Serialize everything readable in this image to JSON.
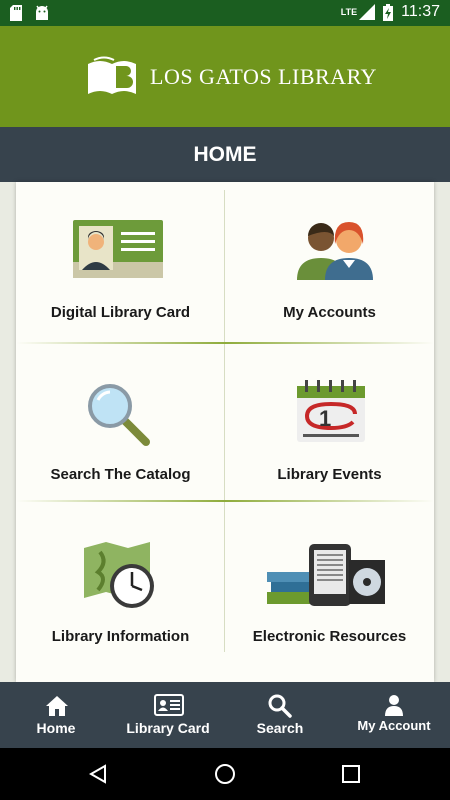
{
  "status_bar": {
    "time": "11:37",
    "network": "LTE",
    "icons": [
      "sd-card-icon",
      "android-icon",
      "signal-icon",
      "battery-charging-icon"
    ]
  },
  "brand": {
    "name": "LOS GATOS LIBRARY",
    "color": "#70951c"
  },
  "header": {
    "title": "HOME",
    "color": "#37434d"
  },
  "tiles": [
    {
      "label": "Digital Library Card",
      "icon": "library-card-icon"
    },
    {
      "label": "My Accounts",
      "icon": "accounts-people-icon"
    },
    {
      "label": "Search The Catalog",
      "icon": "magnifier-icon"
    },
    {
      "label": "Library Events",
      "icon": "calendar-icon"
    },
    {
      "label": "Library Information",
      "icon": "map-clock-icon"
    },
    {
      "label": "Electronic Resources",
      "icon": "books-ereader-disc-icon"
    }
  ],
  "bottom_nav": [
    {
      "label": "Home",
      "icon": "home-icon"
    },
    {
      "label": "Library Card",
      "icon": "id-card-icon"
    },
    {
      "label": "Search",
      "icon": "search-icon"
    },
    {
      "label": "My Account",
      "icon": "person-icon"
    }
  ],
  "system_nav": [
    "back-icon",
    "home-circle-icon",
    "recents-icon"
  ]
}
